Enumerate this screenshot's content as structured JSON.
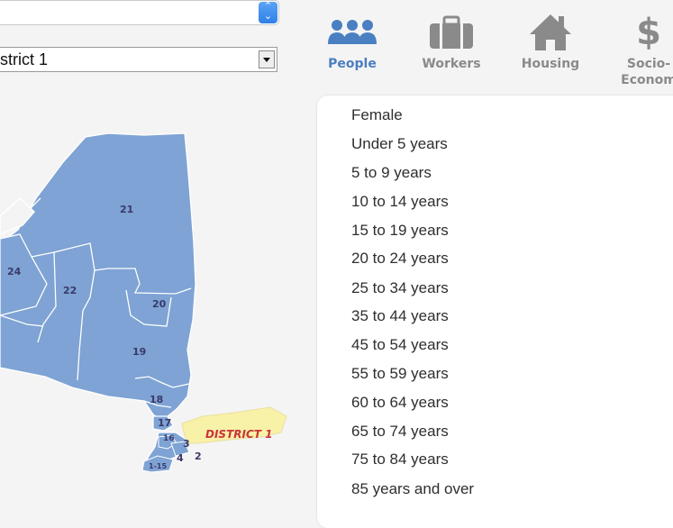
{
  "top_select": {
    "value": ""
  },
  "district_select": {
    "value": "istrict 1"
  },
  "tabs": [
    {
      "label": "People",
      "icon": "people-icon",
      "active": true
    },
    {
      "label": "Workers",
      "icon": "briefcase-icon",
      "active": false
    },
    {
      "label": "Housing",
      "icon": "house-icon",
      "active": false
    },
    {
      "label": "Socio-",
      "label2": "Econom",
      "icon": "dollar-icon",
      "active": false
    }
  ],
  "map": {
    "district_labels": [
      "21",
      "24",
      "22",
      "20",
      "19",
      "18",
      "17",
      "16",
      "3",
      "4",
      "2",
      "1-15"
    ],
    "highlight_label": "DISTRICT 1",
    "colors": {
      "district": "#7ea3d4",
      "highlight": "#f8f1a8",
      "highlight_text": "#c8343a"
    }
  },
  "options": [
    "Female",
    "Under 5 years",
    "5 to 9 years",
    "10 to 14 years",
    "15 to 19 years",
    "20 to 24 years",
    "25 to 34 years",
    "35 to 44 years",
    "45 to 54 years",
    "55 to 59 years",
    "60 to 64 years",
    "65 to 74 years",
    "75 to 84 years",
    "85 years and over"
  ]
}
